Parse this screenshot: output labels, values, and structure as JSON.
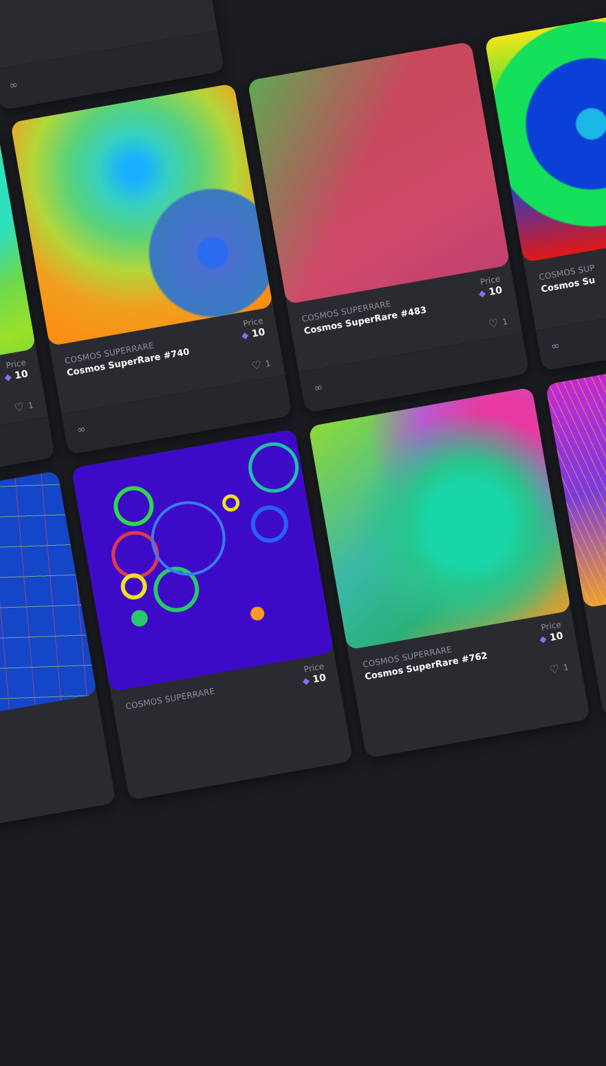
{
  "cards": [
    {
      "collection": "",
      "name": "",
      "price_label": "",
      "price": "",
      "likes": "",
      "icons": [
        "link-icon"
      ]
    },
    {
      "collection": "COSMOS SUPERRARE",
      "name": "Cosmos SuperRare #740",
      "price_label": "Price",
      "price": "10",
      "likes": "1",
      "icons": [
        "eth-icon",
        "heart-icon",
        "link-icon"
      ]
    },
    {
      "collection": "COSMOS SUPERRARE",
      "name": "Cosmos SuperRare #483",
      "price_label": "Price",
      "price": "10",
      "likes": "1",
      "icons": [
        "eth-icon",
        "heart-icon",
        "link-icon"
      ]
    },
    {
      "collection": "COSMOS SUPERRARE",
      "name": "Cosmos SuperRare #762",
      "price_label": "Price",
      "price": "10",
      "likes": "1",
      "icons": [
        "eth-icon",
        "heart-icon"
      ]
    },
    {
      "collection": "COSMOS SUPERRARE",
      "name": "",
      "price_label": "Price",
      "price": "10",
      "likes": "",
      "icons": [
        "eth-icon"
      ]
    }
  ],
  "left_card": {
    "price_label": "Price",
    "price": "10",
    "likes": "1"
  },
  "right_card": {
    "collection": "COSMOS SUP",
    "name": "Cosmos Su"
  },
  "palette": {
    "background": "#1b1c20",
    "card": "#2a2b30",
    "muted_text": "#8d8f98",
    "eth_accent": "#8b6ef0"
  }
}
